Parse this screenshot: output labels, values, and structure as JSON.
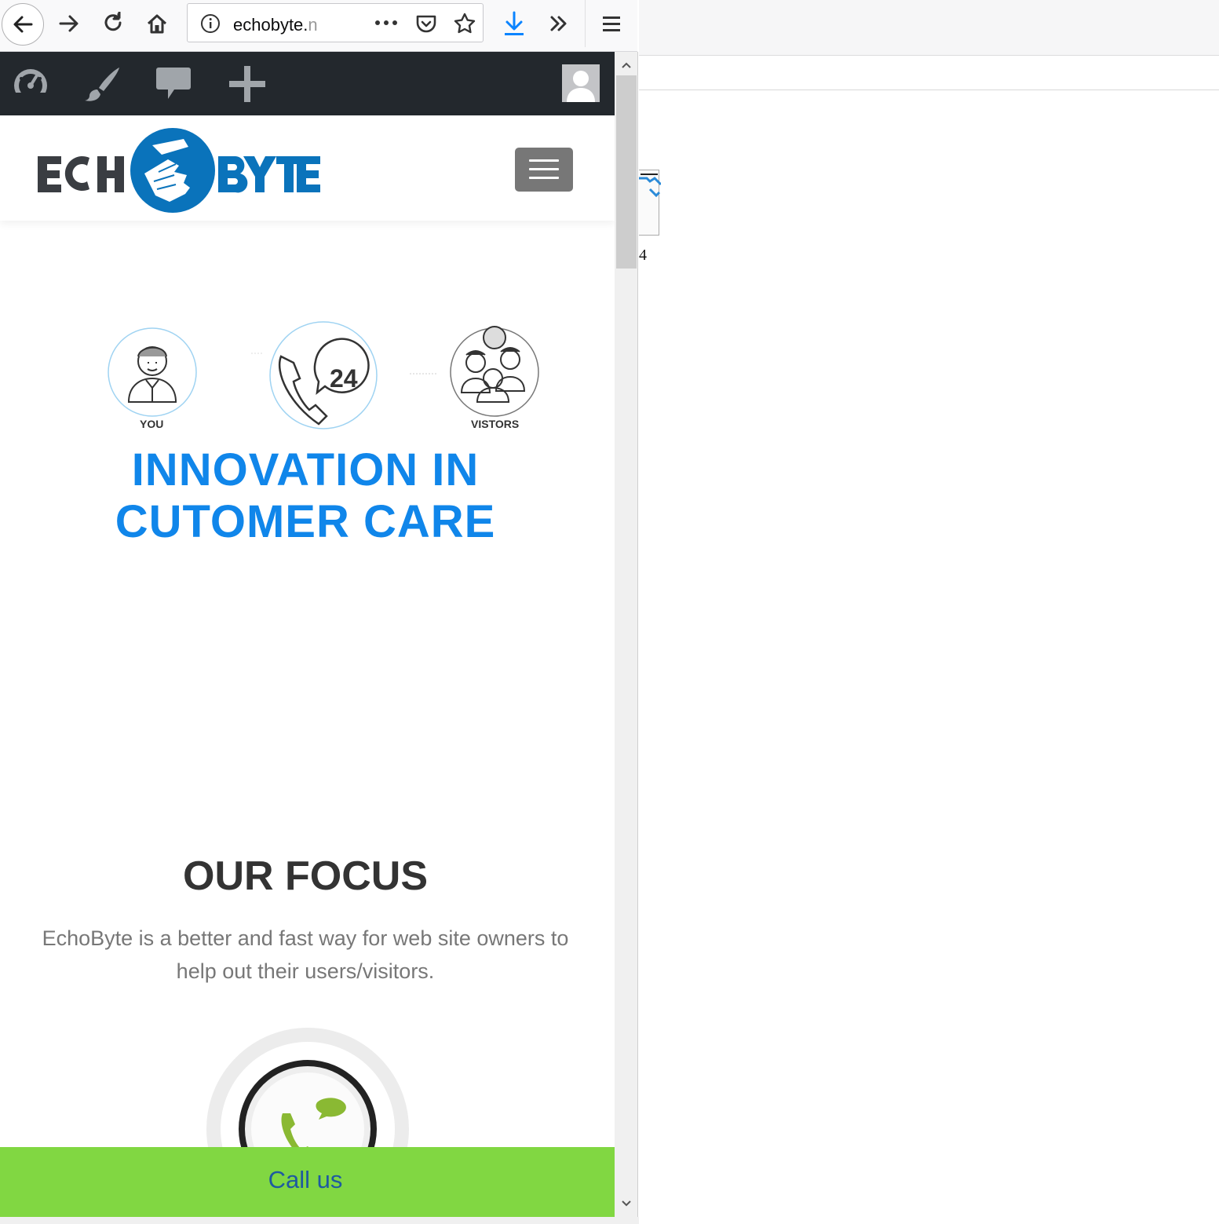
{
  "browser": {
    "url_main": "echobyte.",
    "url_faded": "n"
  },
  "site": {
    "logo_text": "ECHOBYTE",
    "hero_labels": {
      "you": "YOU",
      "support_number": "24",
      "visitors": "VISTORS"
    },
    "hero_title_line1": "INNOVATION IN",
    "hero_title_line2": "CUTOMER CARE",
    "focus_title": "OUR FOCUS",
    "focus_text": "EchoByte is a better and fast way for web site owners to help out their users/visitors.",
    "call_label": "Call us"
  },
  "right_pane": {
    "number": "4"
  },
  "colors": {
    "wp_bar": "#23282d",
    "accent_blue": "#1086ea",
    "logo_blue": "#0a73bb",
    "call_green": "#81d742",
    "call_text": "#1e5aa0"
  }
}
